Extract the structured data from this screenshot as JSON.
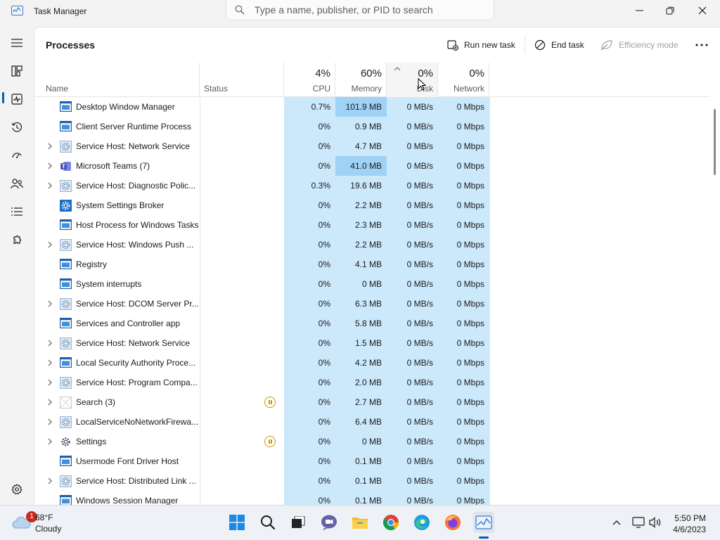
{
  "window": {
    "title": "Task Manager",
    "search_placeholder": "Type a name, publisher, or PID to search"
  },
  "page": {
    "title": "Processes",
    "toolbar": {
      "run_new_task": "Run new task",
      "end_task": "End task",
      "efficiency_mode": "Efficiency mode"
    }
  },
  "columns": {
    "name": "Name",
    "status": "Status",
    "cpu": {
      "pct": "4%",
      "label": "CPU"
    },
    "memory": {
      "pct": "60%",
      "label": "Memory"
    },
    "disk": {
      "pct": "0%",
      "label": "Disk"
    },
    "network": {
      "pct": "0%",
      "label": "Network"
    }
  },
  "processes": [
    {
      "name": "Desktop Window Manager",
      "expandable": false,
      "icon": "window-icon",
      "status": "",
      "cpu": "0.7%",
      "memory": "101.9 MB",
      "mem_high": true,
      "disk": "0 MB/s",
      "network": "0 Mbps"
    },
    {
      "name": "Client Server Runtime Process",
      "expandable": false,
      "icon": "window-icon",
      "status": "",
      "cpu": "0%",
      "memory": "0.9 MB",
      "mem_high": false,
      "disk": "0 MB/s",
      "network": "0 Mbps"
    },
    {
      "name": "Service Host: Network Service",
      "expandable": true,
      "icon": "gear-icon",
      "status": "",
      "cpu": "0%",
      "memory": "4.7 MB",
      "mem_high": false,
      "disk": "0 MB/s",
      "network": "0 Mbps"
    },
    {
      "name": "Microsoft Teams (7)",
      "expandable": true,
      "icon": "teams-icon",
      "status": "",
      "cpu": "0%",
      "memory": "41.0 MB",
      "mem_high": true,
      "disk": "0 MB/s",
      "network": "0 Mbps"
    },
    {
      "name": "Service Host: Diagnostic Polic...",
      "expandable": true,
      "icon": "gear-icon",
      "status": "",
      "cpu": "0.3%",
      "memory": "19.6 MB",
      "mem_high": false,
      "disk": "0 MB/s",
      "network": "0 Mbps"
    },
    {
      "name": "System Settings Broker",
      "expandable": false,
      "icon": "settings-broker-icon",
      "status": "",
      "cpu": "0%",
      "memory": "2.2 MB",
      "mem_high": false,
      "disk": "0 MB/s",
      "network": "0 Mbps"
    },
    {
      "name": "Host Process for Windows Tasks",
      "expandable": false,
      "icon": "window-icon",
      "status": "",
      "cpu": "0%",
      "memory": "2.3 MB",
      "mem_high": false,
      "disk": "0 MB/s",
      "network": "0 Mbps"
    },
    {
      "name": "Service Host: Windows Push ...",
      "expandable": true,
      "icon": "gear-icon",
      "status": "",
      "cpu": "0%",
      "memory": "2.2 MB",
      "mem_high": false,
      "disk": "0 MB/s",
      "network": "0 Mbps"
    },
    {
      "name": "Registry",
      "expandable": false,
      "icon": "window-icon",
      "status": "",
      "cpu": "0%",
      "memory": "4.1 MB",
      "mem_high": false,
      "disk": "0 MB/s",
      "network": "0 Mbps"
    },
    {
      "name": "System interrupts",
      "expandable": false,
      "icon": "window-icon",
      "status": "",
      "cpu": "0%",
      "memory": "0 MB",
      "mem_high": false,
      "disk": "0 MB/s",
      "network": "0 Mbps"
    },
    {
      "name": "Service Host: DCOM Server Pr...",
      "expandable": true,
      "icon": "gear-icon",
      "status": "",
      "cpu": "0%",
      "memory": "6.3 MB",
      "mem_high": false,
      "disk": "0 MB/s",
      "network": "0 Mbps"
    },
    {
      "name": "Services and Controller app",
      "expandable": false,
      "icon": "window-icon",
      "status": "",
      "cpu": "0%",
      "memory": "5.8 MB",
      "mem_high": false,
      "disk": "0 MB/s",
      "network": "0 Mbps"
    },
    {
      "name": "Service Host: Network Service",
      "expandable": true,
      "icon": "gear-icon",
      "status": "",
      "cpu": "0%",
      "memory": "1.5 MB",
      "mem_high": false,
      "disk": "0 MB/s",
      "network": "0 Mbps"
    },
    {
      "name": "Local Security Authority Proce...",
      "expandable": true,
      "icon": "window-icon",
      "status": "",
      "cpu": "0%",
      "memory": "4.2 MB",
      "mem_high": false,
      "disk": "0 MB/s",
      "network": "0 Mbps"
    },
    {
      "name": "Service Host: Program Compa...",
      "expandable": true,
      "icon": "gear-icon",
      "status": "",
      "cpu": "0%",
      "memory": "2.0 MB",
      "mem_high": false,
      "disk": "0 MB/s",
      "network": "0 Mbps"
    },
    {
      "name": "Search (3)",
      "expandable": true,
      "icon": "search-app-icon",
      "status": "suspended",
      "cpu": "0%",
      "memory": "2.7 MB",
      "mem_high": false,
      "disk": "0 MB/s",
      "network": "0 Mbps"
    },
    {
      "name": "LocalServiceNoNetworkFirewa...",
      "expandable": true,
      "icon": "gear-icon",
      "status": "",
      "cpu": "0%",
      "memory": "6.4 MB",
      "mem_high": false,
      "disk": "0 MB/s",
      "network": "0 Mbps"
    },
    {
      "name": "Settings",
      "expandable": true,
      "icon": "settings-gear-icon",
      "status": "suspended",
      "cpu": "0%",
      "memory": "0 MB",
      "mem_high": false,
      "disk": "0 MB/s",
      "network": "0 Mbps"
    },
    {
      "name": "Usermode Font Driver Host",
      "expandable": false,
      "icon": "window-icon",
      "status": "",
      "cpu": "0%",
      "memory": "0.1 MB",
      "mem_high": false,
      "disk": "0 MB/s",
      "network": "0 Mbps"
    },
    {
      "name": "Service Host: Distributed Link ...",
      "expandable": true,
      "icon": "gear-icon",
      "status": "",
      "cpu": "0%",
      "memory": "0.1 MB",
      "mem_high": false,
      "disk": "0 MB/s",
      "network": "0 Mbps"
    },
    {
      "name": "Windows Session Manager",
      "expandable": false,
      "icon": "window-icon",
      "status": "",
      "cpu": "0%",
      "memory": "0.1 MB",
      "mem_high": false,
      "disk": "0 MB/s",
      "network": "0 Mbps"
    }
  ],
  "taskbar": {
    "weather_temp": "68°F",
    "weather_desc": "Cloudy",
    "weather_badge": "1",
    "time": "5:50 PM",
    "date": "4/6/2023"
  },
  "colors": {
    "accent": "#005fb8",
    "cell_bg": "#cce8fb",
    "cell_bg_high": "#9fd2f5",
    "suspended": "#c89b00"
  }
}
